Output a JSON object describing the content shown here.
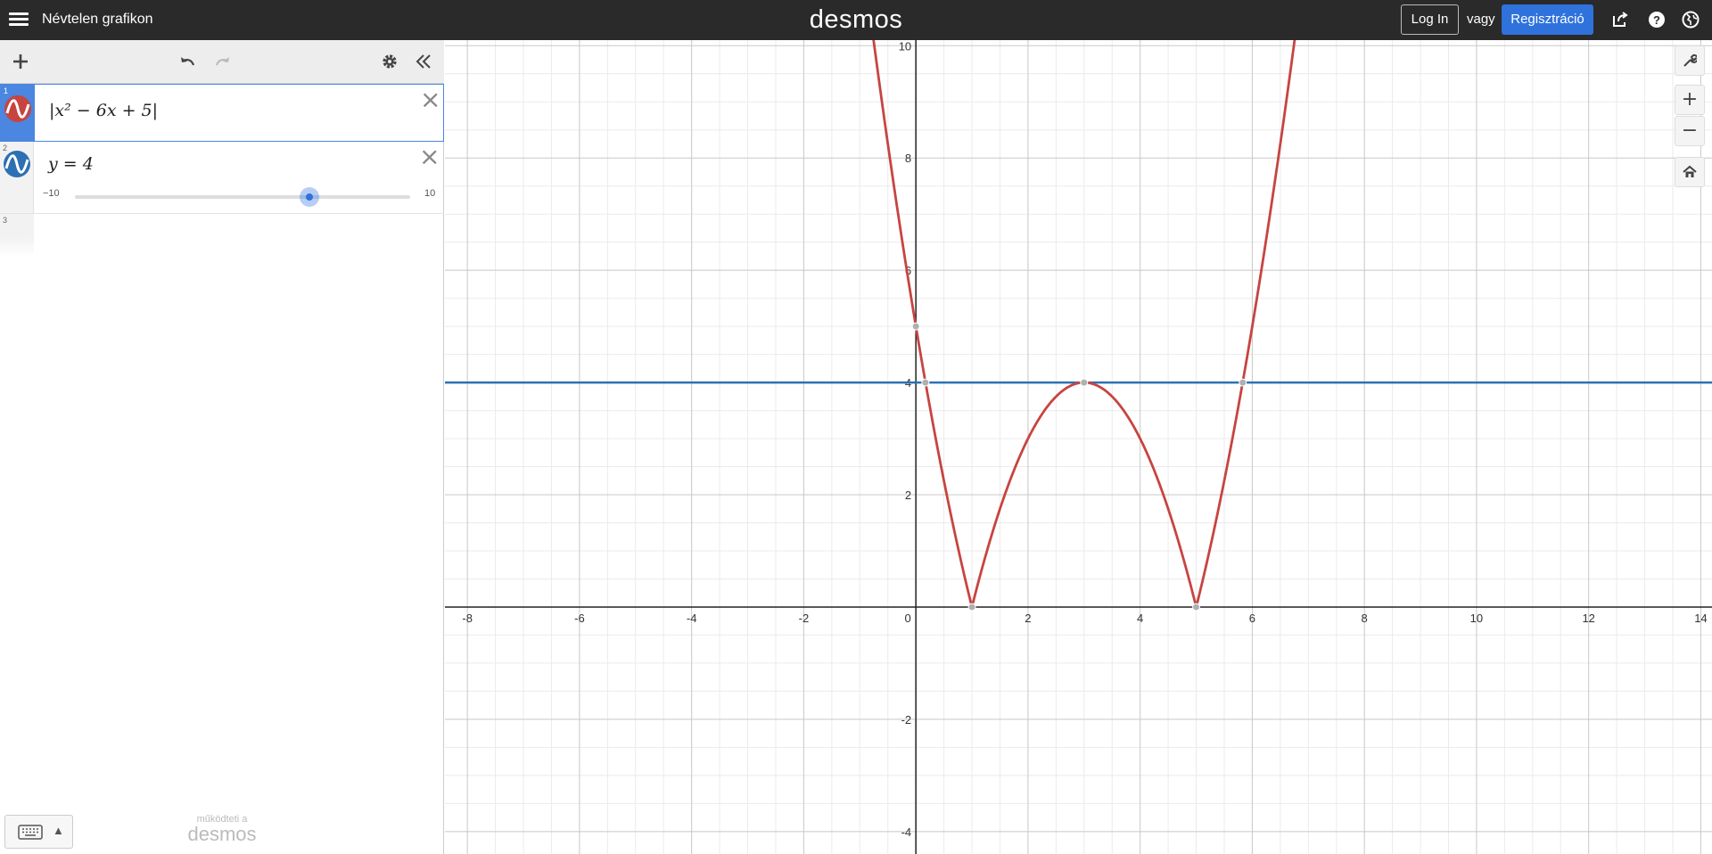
{
  "header": {
    "graph_title": "Névtelen grafikon",
    "brand": "desmos",
    "login_label": "Log In",
    "or_label": "vagy",
    "signup_label": "Regisztráció",
    "icons": [
      "menu-icon",
      "share-icon",
      "help-icon",
      "language-globe-icon"
    ]
  },
  "expressions": [
    {
      "index": "1",
      "latex_text": "|x² − 6x + 5|",
      "color": "#c74440",
      "selected": true
    },
    {
      "index": "2",
      "latex_text": "y = 4",
      "color": "#2d70b3",
      "slider": {
        "min_label": "−10",
        "max_label": "10",
        "value": 4
      }
    },
    {
      "index": "3",
      "latex_text": ""
    }
  ],
  "footer": {
    "powered_by": "működteti a",
    "powered_brand": "desmos"
  },
  "graph": {
    "x_range": [
      -8.4,
      14.2
    ],
    "y_range": [
      -4.4,
      10.1
    ],
    "x_ticks": [
      "-8",
      "-6",
      "-4",
      "-2",
      "0",
      "2",
      "4",
      "6",
      "8",
      "10",
      "12",
      "14"
    ],
    "y_ticks": [
      "-4",
      "-2",
      "2",
      "4",
      "6",
      "8",
      "10"
    ],
    "curve_color": "#c74440",
    "line_color": "#2d70b3"
  },
  "chart_data": {
    "type": "line",
    "series": [
      {
        "name": "|x^2 - 6x + 5|",
        "function": "abs(x^2-6x+5)"
      },
      {
        "name": "y = 4",
        "function": "4"
      }
    ],
    "points_of_interest": [
      {
        "x": 0,
        "y": 5
      },
      {
        "x": 0.17,
        "y": 4
      },
      {
        "x": 1,
        "y": 0
      },
      {
        "x": 3,
        "y": 4
      },
      {
        "x": 5,
        "y": 0
      },
      {
        "x": 5.83,
        "y": 4
      }
    ],
    "xlim": [
      -8.4,
      14.2
    ],
    "ylim": [
      -4.4,
      10.1
    ],
    "grid": true
  }
}
